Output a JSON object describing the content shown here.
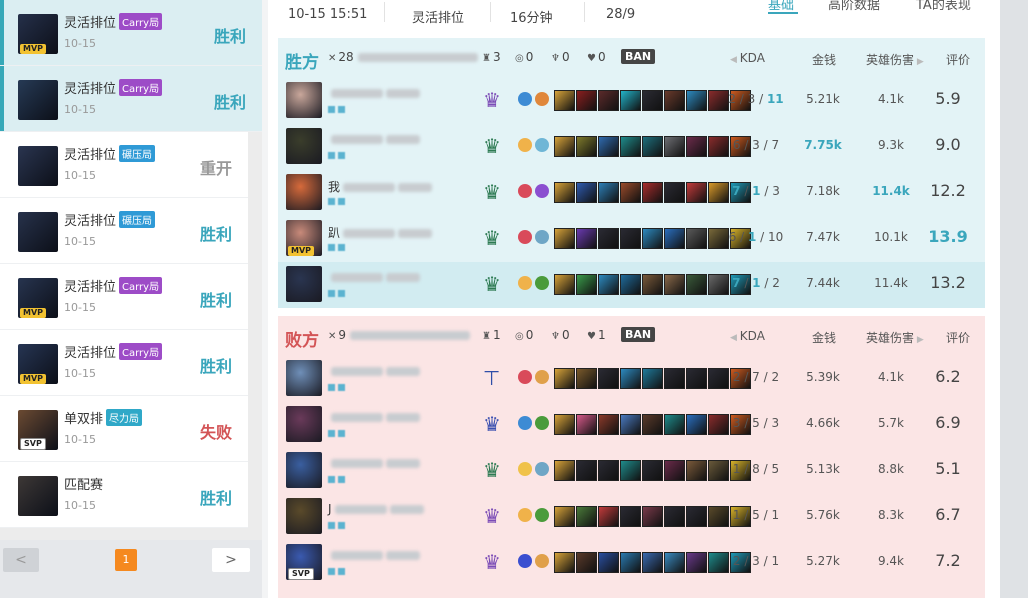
{
  "sidebar": {
    "matches": [
      {
        "mode": "灵活排位",
        "tag": "Carry局",
        "tag_kind": "carry",
        "date": "10-15",
        "result": "胜利",
        "result_kind": "win",
        "badge": "MVP",
        "badge_kind": "mvp",
        "avatar_color": "#25304a",
        "selected": true
      },
      {
        "mode": "灵活排位",
        "tag": "Carry局",
        "tag_kind": "carry",
        "date": "10-15",
        "result": "胜利",
        "result_kind": "win",
        "badge": "",
        "badge_kind": "",
        "avatar_color": "#263a55",
        "selected": true
      },
      {
        "mode": "灵活排位",
        "tag": "碾压局",
        "tag_kind": "crush",
        "date": "10-15",
        "result": "重开",
        "result_kind": "remake",
        "badge": "",
        "badge_kind": "",
        "avatar_color": "#2a3550",
        "selected": false
      },
      {
        "mode": "灵活排位",
        "tag": "碾压局",
        "tag_kind": "crush",
        "date": "10-15",
        "result": "胜利",
        "result_kind": "win",
        "badge": "",
        "badge_kind": "",
        "avatar_color": "#27324b",
        "selected": false
      },
      {
        "mode": "灵活排位",
        "tag": "Carry局",
        "tag_kind": "carry",
        "date": "10-15",
        "result": "胜利",
        "result_kind": "win",
        "badge": "MVP",
        "badge_kind": "mvp",
        "avatar_color": "#27344f",
        "selected": false
      },
      {
        "mode": "灵活排位",
        "tag": "Carry局",
        "tag_kind": "carry",
        "date": "10-15",
        "result": "胜利",
        "result_kind": "win",
        "badge": "MVP",
        "badge_kind": "mvp",
        "avatar_color": "#263553",
        "selected": false
      },
      {
        "mode": "单双排",
        "tag": "尽力局",
        "tag_kind": "effort",
        "date": "10-15",
        "result": "失败",
        "result_kind": "loss",
        "badge": "SVP",
        "badge_kind": "svp",
        "avatar_color": "#6b4a32",
        "selected": false
      },
      {
        "mode": "匹配赛",
        "tag": "",
        "tag_kind": "",
        "date": "10-15",
        "result": "胜利",
        "result_kind": "win",
        "badge": "",
        "badge_kind": "",
        "avatar_color": "#3d3836",
        "selected": false
      }
    ],
    "pager": {
      "prev": "<",
      "page": "1",
      "next": ">"
    }
  },
  "header": {
    "datetime": "10-15 15:51",
    "mode": "灵活排位",
    "duration": "16分钟",
    "score": "28/9",
    "tabs": [
      "基础",
      "高阶数据",
      "TA的表现"
    ]
  },
  "columns": {
    "kda": "KDA",
    "gold": "金钱",
    "damage": "英雄伤害",
    "rating": "评价",
    "ban": "BAN"
  },
  "teams": [
    {
      "title": "胜方",
      "kind": "win",
      "kills": "28",
      "towers": "3",
      "dragons": "0",
      "barons": "0",
      "heralds": "0",
      "gold_blur": "",
      "players": [
        {
          "name_prefix": "",
          "kda": [
            "2",
            "3",
            "11"
          ],
          "kda_em": [
            false,
            false,
            true
          ],
          "gold": "5.21k",
          "gold_em": false,
          "damage": "4.1k",
          "damage_em": false,
          "rating": "5.9",
          "rating_em": false,
          "badge": "",
          "badge_kind": "",
          "avatar": "#c9a79b",
          "rank": "♛",
          "rank_color": "#7b4bb6",
          "spells": [
            "#3d8bd4",
            "#e0873b"
          ],
          "items": [
            "#d7a33a",
            "#8a1f1f",
            "#5b2a2a",
            "#22b3c9",
            "#2b2b33",
            "#6a3a2b",
            "#2d8ac0",
            "#8a2c2c",
            "#cf5b1f"
          ],
          "hl": false
        },
        {
          "name_prefix": "",
          "kda": [
            "6",
            "3",
            "7"
          ],
          "kda_em": [
            false,
            false,
            false
          ],
          "gold": "7.75k",
          "gold_em": true,
          "damage": "9.3k",
          "damage_em": false,
          "rating": "9.0",
          "rating_em": false,
          "badge": "",
          "badge_kind": "",
          "avatar": "#3a3d2b",
          "rank": "♛",
          "rank_color": "#2c7a52",
          "spells": [
            "#f0b24a",
            "#6fb6d6"
          ],
          "items": [
            "#d7a33a",
            "#7e7a2b",
            "#2f6bb0",
            "#1f8c8c",
            "#1e6f7d",
            "#6e6f74",
            "#6b2b4a",
            "#8a2c2c",
            "#cf5b1f"
          ],
          "hl": false
        },
        {
          "name_prefix": "我",
          "kda": [
            "7",
            "1",
            "3"
          ],
          "kda_em": [
            true,
            true,
            false
          ],
          "gold": "7.18k",
          "gold_em": false,
          "damage": "11.4k",
          "damage_em": true,
          "rating": "12.2",
          "rating_em": false,
          "badge": "",
          "badge_kind": "",
          "avatar": "#d66a3b",
          "rank": "♛",
          "rank_color": "#2c7a52",
          "spells": [
            "#d94a5a",
            "#8b4fd0"
          ],
          "items": [
            "#d7a33a",
            "#2f5cb0",
            "#2d7fb7",
            "#9a4b2b",
            "#a82d2d",
            "#2a2a33",
            "#c23b3b",
            "#d99a2a",
            "#1f9ab8"
          ],
          "hl": false
        },
        {
          "name_prefix": "趴",
          "kda": [
            "6",
            "1",
            "10"
          ],
          "kda_em": [
            false,
            true,
            false
          ],
          "gold": "7.47k",
          "gold_em": false,
          "damage": "10.1k",
          "damage_em": false,
          "rating": "13.9",
          "rating_em": true,
          "badge": "MVP",
          "badge_kind": "mvp",
          "avatar": "#c88a7a",
          "rank": "♛",
          "rank_color": "#2c7a52",
          "spells": [
            "#d94a5a",
            "#6fa6c6"
          ],
          "items": [
            "#d7a33a",
            "#6a3ab0",
            "#2a2a33",
            "#2a2a33",
            "#2d8ac0",
            "#2a6fbf",
            "#5a5a5a",
            "#7a6a3a",
            "#d8b32a"
          ],
          "hl": false
        },
        {
          "name_prefix": "",
          "kda": [
            "7",
            "1",
            "2"
          ],
          "kda_em": [
            true,
            true,
            false
          ],
          "gold": "7.44k",
          "gold_em": false,
          "damage": "11.4k",
          "damage_em": false,
          "rating": "13.2",
          "rating_em": false,
          "badge": "",
          "badge_kind": "",
          "avatar": "#2a3550",
          "rank": "♛",
          "rank_color": "#2c7a52",
          "spells": [
            "#f0b24a",
            "#4a9b3b"
          ],
          "items": [
            "#d7a33a",
            "#3a9b4a",
            "#2d8ac0",
            "#1f6b9b",
            "#7a5a3a",
            "#8a6a4a",
            "#3a5a3a",
            "#6a6a6a",
            "#1f9ab8"
          ],
          "hl": true
        }
      ]
    },
    {
      "title": "败方",
      "kind": "loss",
      "kills": "9",
      "towers": "1",
      "dragons": "0",
      "barons": "0",
      "heralds": "1",
      "gold_blur": "",
      "players": [
        {
          "name_prefix": "",
          "kda": [
            "2",
            "7",
            "2"
          ],
          "kda_em": [
            false,
            false,
            false
          ],
          "gold": "5.39k",
          "gold_em": false,
          "damage": "4.1k",
          "damage_em": false,
          "rating": "6.2",
          "rating_em": false,
          "badge": "",
          "badge_kind": "",
          "avatar": "#6f8fb8",
          "rank": "⊤",
          "rank_color": "#2f4ea8",
          "spells": [
            "#d94a5a",
            "#e0a04a"
          ],
          "items": [
            "#d7a33a",
            "#7a5a2b",
            "#2a2a33",
            "#2d8ac0",
            "#1f7a9b",
            "#2a2a33",
            "#2a2a33",
            "#2a2a33",
            "#cf5b1f"
          ],
          "hl": false
        },
        {
          "name_prefix": "",
          "kda": [
            "3",
            "5",
            "3"
          ],
          "kda_em": [
            false,
            false,
            false
          ],
          "gold": "4.66k",
          "gold_em": false,
          "damage": "5.7k",
          "damage_em": false,
          "rating": "6.9",
          "rating_em": false,
          "badge": "",
          "badge_kind": "",
          "avatar": "#6a3a5a",
          "rank": "♛",
          "rank_color": "#3a4fb0",
          "spells": [
            "#3d8bd4",
            "#4a9b3b"
          ],
          "items": [
            "#d7a33a",
            "#d65a8a",
            "#8a3a2a",
            "#4a7ac0",
            "#5a3a2a",
            "#1f8c8c",
            "#2a6fbf",
            "#8a2c2c",
            "#cf5b1f"
          ],
          "hl": false
        },
        {
          "name_prefix": "",
          "kda": [
            "1",
            "8",
            "5"
          ],
          "kda_em": [
            false,
            false,
            false
          ],
          "gold": "5.13k",
          "gold_em": false,
          "damage": "8.8k",
          "damage_em": false,
          "rating": "5.1",
          "rating_em": false,
          "badge": "",
          "badge_kind": "",
          "avatar": "#3a5fa0",
          "rank": "♛",
          "rank_color": "#2c7a52",
          "spells": [
            "#f0c24a",
            "#6fa6c6"
          ],
          "items": [
            "#d7a33a",
            "#2a2a33",
            "#2a2a33",
            "#1f8c8c",
            "#2a2a33",
            "#6b2b4a",
            "#7a5a3a",
            "#6a5a3a",
            "#d8b32a"
          ],
          "hl": false
        },
        {
          "name_prefix": "J",
          "kda": [
            "1",
            "5",
            "1"
          ],
          "kda_em": [
            false,
            false,
            false
          ],
          "gold": "5.76k",
          "gold_em": false,
          "damage": "8.3k",
          "damage_em": false,
          "rating": "6.7",
          "rating_em": false,
          "badge": "",
          "badge_kind": "",
          "avatar": "#5a4a2a",
          "rank": "♛",
          "rank_color": "#7b4bb6",
          "spells": [
            "#f0b24a",
            "#4a9b3b"
          ],
          "items": [
            "#d7a33a",
            "#4a7a3a",
            "#c23b3b",
            "#2a2a33",
            "#7a3a4a",
            "#2a2a33",
            "#2a2a33",
            "#5a4a2a",
            "#d8b32a"
          ],
          "hl": false
        },
        {
          "name_prefix": "",
          "kda": [
            "2",
            "3",
            "1"
          ],
          "kda_em": [
            false,
            false,
            false
          ],
          "gold": "5.27k",
          "gold_em": false,
          "damage": "9.4k",
          "damage_em": false,
          "rating": "7.2",
          "rating_em": false,
          "badge": "SVP",
          "badge_kind": "svp",
          "avatar": "#3a5ab0",
          "rank": "♛",
          "rank_color": "#7b4bb6",
          "spells": [
            "#3a4fd0",
            "#e0a04a"
          ],
          "items": [
            "#d7a33a",
            "#5a3a2a",
            "#2a4fa0",
            "#2a7ab0",
            "#3a6ab0",
            "#3a8ac0",
            "#6a3a8a",
            "#1f8c8c",
            "#1f9ab8"
          ],
          "hl": false
        }
      ]
    }
  ]
}
